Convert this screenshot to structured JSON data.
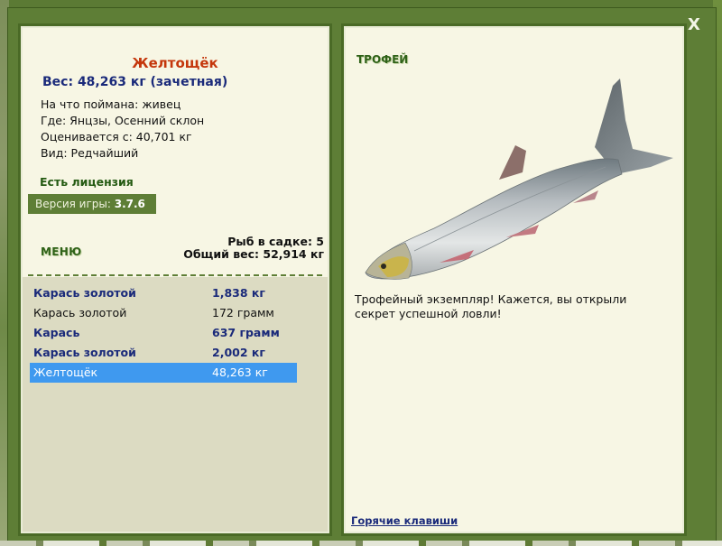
{
  "close_label": "X",
  "fish": {
    "name": "Желтощёк",
    "weight_line": "Вес: 48,263 кг (зачетная)",
    "caught_on": "На что поймана: живец",
    "where": "Где: Янцзы, Осенний склон",
    "rated_from": "Оценивается с: 40,701 кг",
    "kind": "Вид: Редчайший"
  },
  "license": "Есть лицензия",
  "version": {
    "label": "Версия игры: ",
    "value": "3.7.6"
  },
  "menu_label": "МЕНЮ",
  "cage": {
    "count": "Рыб в садке: 5",
    "total": "Общий вес: 52,914 кг"
  },
  "catch_list": [
    {
      "name": "Карась золотой",
      "weight": "1,838 кг"
    },
    {
      "name": "Карась золотой",
      "weight": "172 грамм"
    },
    {
      "name": "Карась",
      "weight": "637 грамм"
    },
    {
      "name": "Карась золотой",
      "weight": "2,002 кг"
    },
    {
      "name": "Желтощёк",
      "weight": "48,263 кг"
    }
  ],
  "trophy_label": "ТРОФЕЙ",
  "fish_image_icon": "fish-image",
  "trophy_text": "Трофейный экземпляр! Кажется, вы открыли секрет успешной ловли!",
  "hotkeys_label": "Горячие клавиши",
  "colors": {
    "frame": "#5e7e36",
    "panel": "#f7f6e4",
    "selected": "#3f99ef",
    "fish_name": "#c4360b"
  }
}
